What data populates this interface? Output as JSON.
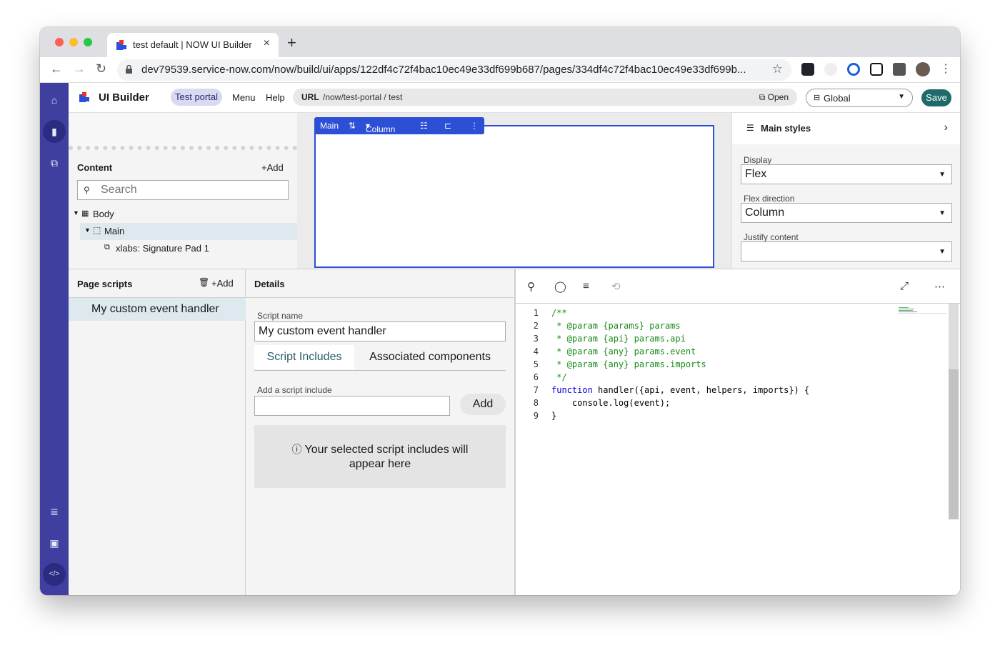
{
  "browser": {
    "tab_title": "test default | NOW UI Builder",
    "url": "dev79539.service-now.com/now/build/ui/apps/122df4c72f4bac10ec49e33df699b687/pages/334df4c72f4bac10ec49e33df699b..."
  },
  "app": {
    "title": "UI Builder",
    "experience": "Test portal",
    "menu_label": "Menu",
    "help_label": "Help",
    "url_label": "URL",
    "url_path": "/now/test-portal / test",
    "open_label": "Open",
    "scope": "Global",
    "save_label": "Save"
  },
  "canvas_toolbar": {
    "container": "Main",
    "layout": "Column"
  },
  "content_panel": {
    "title": "Content",
    "add_label": "Add",
    "search_placeholder": "Search",
    "tree": [
      "Body",
      "Main",
      "xlabs: Signature Pad 1"
    ]
  },
  "styles_panel": {
    "title": "Main styles",
    "display_label": "Display",
    "display_value": "Flex",
    "flex_direction_label": "Flex direction",
    "flex_direction_value": "Column",
    "justify_content_label": "Justify content",
    "justify_content_value": ""
  },
  "scripts_panel": {
    "title": "Page scripts",
    "add_label": "Add",
    "items": [
      "My custom event handler"
    ]
  },
  "details_panel": {
    "title": "Details",
    "script_name_label": "Script name",
    "script_name_value": "My custom event handler",
    "tabs": [
      "Script Includes",
      "Associated components"
    ],
    "add_include_label": "Add a script include",
    "add_include_value": "",
    "add_button": "Add",
    "empty_message_line1": "Your selected script includes will",
    "empty_message_line2": "appear here"
  },
  "code_editor": {
    "lines": [
      "/**",
      " * @param {params} params",
      " * @param {api} params.api",
      " * @param {any} params.event",
      " * @param {any} params.imports",
      " */",
      "function handler({api, event, helpers, imports}) {",
      "    console.log(event);",
      "}"
    ],
    "line_numbers": [
      "1",
      "2",
      "3",
      "4",
      "5",
      "6",
      "7",
      "8",
      "9"
    ]
  },
  "colors": {
    "rail": "#3f3fa0",
    "accent_blue": "#2c4fd6",
    "save_button": "#1f6b6b",
    "selection": "#dde9ee"
  }
}
